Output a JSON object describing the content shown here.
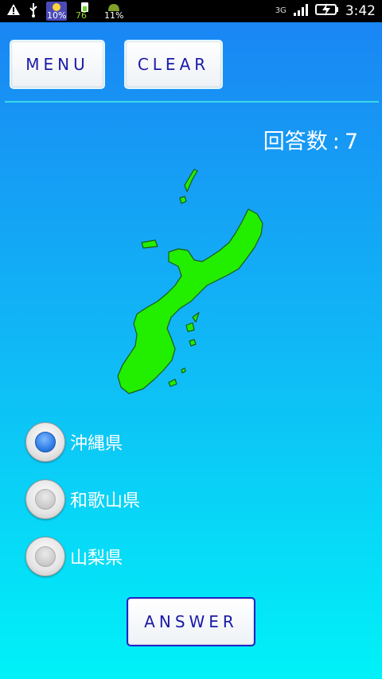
{
  "status_bar": {
    "time": "3:42",
    "network": "3G",
    "weather_badge": "10%",
    "battery_badge": "76",
    "android_badge": "11%",
    "icons": [
      "warning-icon",
      "usb-icon",
      "weather-icon",
      "battery-level-icon",
      "android-icon",
      "network-3g-icon",
      "signal-icon",
      "battery-charging-icon"
    ]
  },
  "toolbar": {
    "menu_label": "MENU",
    "clear_label": "CLEAR"
  },
  "score": {
    "label": "回答数",
    "separator": ":",
    "value": "7"
  },
  "question": {
    "image": "okinawa-prefecture-map",
    "map_color": "#22ee00"
  },
  "options": [
    {
      "label": "沖縄県",
      "selected": true
    },
    {
      "label": "和歌山県",
      "selected": false
    },
    {
      "label": "山梨県",
      "selected": false
    }
  ],
  "answer_label": "ANSWER",
  "colors": {
    "button_text": "#1a1aa8",
    "gradient_top": "#1a86f4",
    "gradient_bottom": "#00f2f8",
    "divider": "#3ad8ea",
    "radio_selected": "#2f7fe6"
  }
}
